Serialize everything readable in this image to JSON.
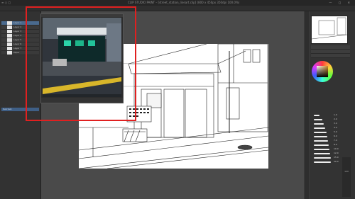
{
  "titlebar": {
    "menu": "≡ ○ ▢",
    "title": "CLIP STUDIO PAINT – [street_station_lineart.clip] (800 x 450px 350dpi 100.0%)",
    "window_buttons": "— ▢ ✕"
  },
  "layers": {
    "items": [
      {
        "label": "Layer 1"
      },
      {
        "label": "Layer 2"
      },
      {
        "label": "Layer 3"
      },
      {
        "label": "Layer 4"
      },
      {
        "label": "Layer 5"
      },
      {
        "label": "Layer 6"
      },
      {
        "label": "Layer 7"
      },
      {
        "label": "Paper"
      }
    ],
    "selected_index": 0
  },
  "subtool_tab": "Sub tool",
  "right_panel": {
    "color_accent": "#c98a2a",
    "brush_sizes": [
      "1.0",
      "2.0",
      "3.0",
      "4.0",
      "5.0",
      "6.0",
      "7.0",
      "8.0",
      "10.0",
      "12.0",
      "15.0",
      "20.0"
    ],
    "zoom_label": "100"
  },
  "highlight_color": "#e02020"
}
